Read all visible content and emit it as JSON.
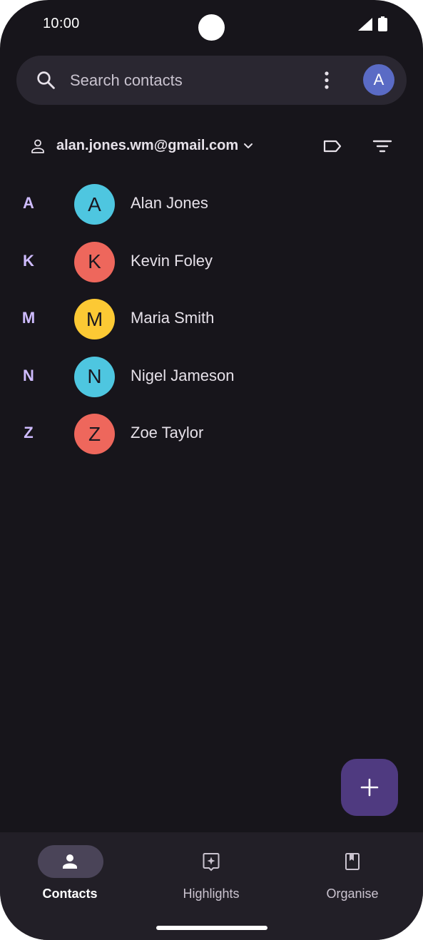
{
  "status_bar": {
    "time": "10:00"
  },
  "search": {
    "placeholder": "Search contacts",
    "value": "",
    "profile_initial": "A"
  },
  "account": {
    "email": "alan.jones.wm@gmail.com"
  },
  "contacts": [
    {
      "section": "A",
      "initial": "A",
      "name": "Alan Jones",
      "color": "#4ec6e0"
    },
    {
      "section": "K",
      "initial": "K",
      "name": "Kevin Foley",
      "color": "#ee675c"
    },
    {
      "section": "M",
      "initial": "M",
      "name": "Maria Smith",
      "color": "#fcc934"
    },
    {
      "section": "N",
      "initial": "N",
      "name": "Nigel Jameson",
      "color": "#4ec6e0"
    },
    {
      "section": "Z",
      "initial": "Z",
      "name": "Zoe Taylor",
      "color": "#ee675c"
    }
  ],
  "bottom_nav": {
    "items": [
      {
        "label": "Contacts",
        "icon": "person-icon",
        "selected": true
      },
      {
        "label": "Highlights",
        "icon": "highlights-icon",
        "selected": false
      },
      {
        "label": "Organise",
        "icon": "bookmark-icon",
        "selected": false
      }
    ]
  },
  "colors": {
    "background": "#17151b",
    "accent": "#cfbcff",
    "fab": "#4f3a80",
    "nav_selected_pill": "#4a4458"
  }
}
